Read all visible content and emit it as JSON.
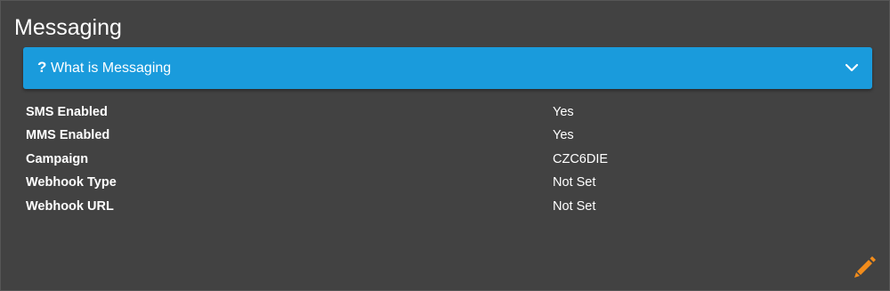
{
  "section": {
    "title": "Messaging"
  },
  "accordion": {
    "icon": "question-mark-icon",
    "icon_glyph": "?",
    "label": "What is Messaging",
    "expand_icon": "chevron-down-icon",
    "background_color": "#1a9bdc"
  },
  "settings": [
    {
      "label": "SMS Enabled",
      "value": "Yes"
    },
    {
      "label": "MMS Enabled",
      "value": "Yes"
    },
    {
      "label": "Campaign",
      "value": "CZC6DIE"
    },
    {
      "label": "Webhook Type",
      "value": "Not Set"
    },
    {
      "label": "Webhook URL",
      "value": "Not Set"
    }
  ],
  "edit": {
    "icon": "pencil-icon",
    "color": "#f28c1b"
  },
  "colors": {
    "background": "#424242",
    "text": "#ffffff"
  }
}
